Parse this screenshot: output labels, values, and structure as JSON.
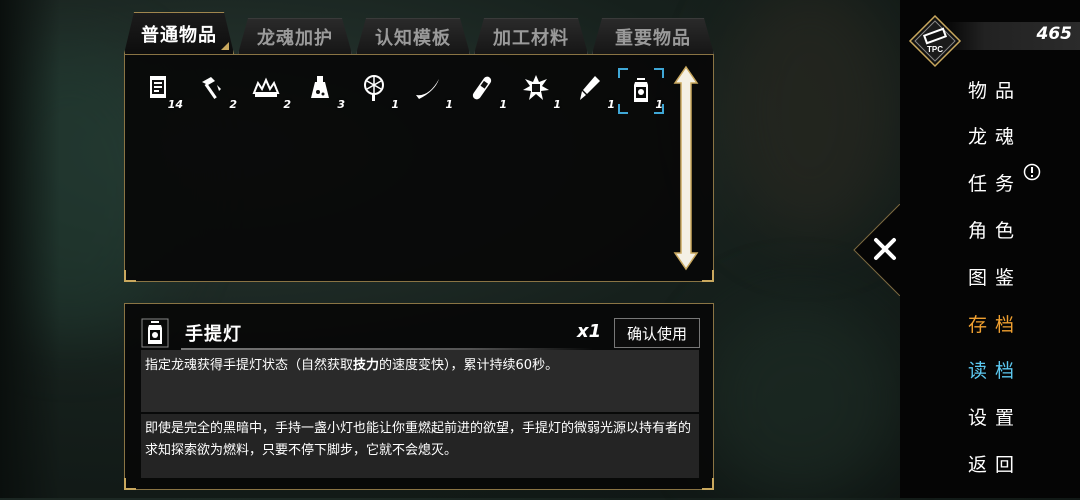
{
  "tabs": [
    {
      "label": "普通物品",
      "active": true
    },
    {
      "label": "龙魂加护",
      "active": false
    },
    {
      "label": "认知模板",
      "active": false
    },
    {
      "label": "加工材料",
      "active": false
    },
    {
      "label": "重要物品",
      "active": false
    }
  ],
  "items": [
    {
      "icon": "scroll-document-icon",
      "count": "14"
    },
    {
      "icon": "hammer-pick-icon",
      "count": "2"
    },
    {
      "icon": "crown-icon",
      "count": "2"
    },
    {
      "icon": "potion-bottle-icon",
      "count": "3"
    },
    {
      "icon": "net-icon",
      "count": "1"
    },
    {
      "icon": "horn-icon",
      "count": "1"
    },
    {
      "icon": "capsule-icon",
      "count": "1"
    },
    {
      "icon": "burst-card-icon",
      "count": "1"
    },
    {
      "icon": "brush-icon",
      "count": "1"
    },
    {
      "icon": "lantern-icon",
      "count": "1",
      "selected": true
    }
  ],
  "detail": {
    "name": "手提灯",
    "quantity": "x1",
    "use_label": "确认使用",
    "effect_prefix": "指定龙魂获得手提灯状态（自然获取",
    "effect_bold": "技力",
    "effect_suffix": "的速度变快），累计持续60秒。",
    "lore": "即使是完全的黑暗中，手持一盏小灯也能让你重燃起前进的欲望，手提灯的微弱光源以持有者的求知探索欲为燃料，只要不停下脚步，它就不会熄灭。"
  },
  "currency": {
    "badge": "TPC",
    "value": "465"
  },
  "menu": [
    {
      "label": "物品"
    },
    {
      "label": "龙魂"
    },
    {
      "label": "任务"
    },
    {
      "label": "角色"
    },
    {
      "label": "图鉴"
    },
    {
      "label": "存档"
    },
    {
      "label": "读档"
    },
    {
      "label": "设置"
    },
    {
      "label": "返回"
    }
  ],
  "colors": {
    "accent_gold": "#c9a85e",
    "save": "#f0a030",
    "load": "#5cc8f0",
    "select": "#3fa7d6"
  }
}
